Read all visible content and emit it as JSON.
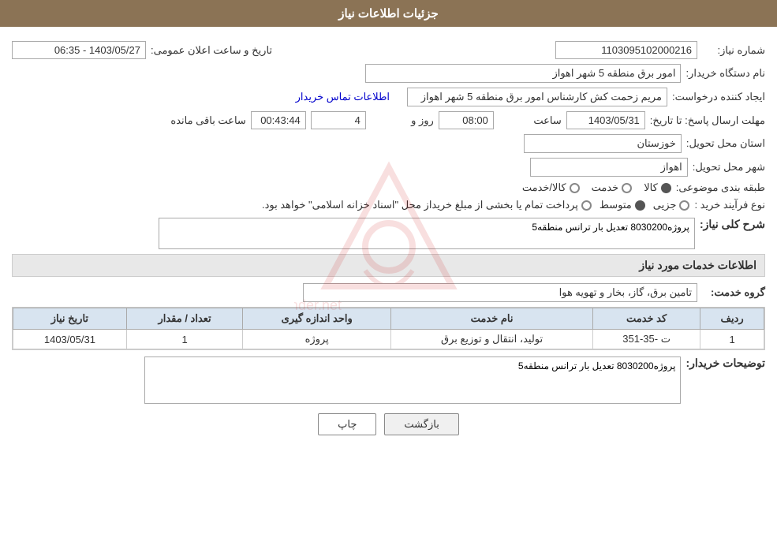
{
  "header": {
    "title": "جزئیات اطلاعات نیاز"
  },
  "fields": {
    "shomareNiaz_label": "شماره نیاز:",
    "shomareNiaz_value": "1103095102000216",
    "namDastgah_label": "نام دستگاه خریدار:",
    "namDastgah_value": "امور برق منطقه 5 شهر اهواز",
    "tarikhAlan_label": "تاریخ و ساعت اعلان عمومی:",
    "tarikhAlan_value": "1403/05/27 - 06:35",
    "ijadKonande_label": "ایجاد کننده درخواست:",
    "ijadKonande_value": "مریم زحمت کش کارشناس امور برق منطقه 5 شهر اهواز",
    "etelaat_link": "اطلاعات تماس خریدار",
    "mohlat_label": "مهلت ارسال پاسخ: تا تاریخ:",
    "mohlat_date": "1403/05/31",
    "mohlat_saat_label": "ساعت",
    "mohlat_saat": "08:00",
    "mohlat_roz_label": "روز و",
    "mohlat_roz": "4",
    "mohlat_mande_label": "ساعت باقی مانده",
    "mohlat_mande": "00:43:44",
    "ostan_label": "استان محل تحویل:",
    "ostan_value": "خوزستان",
    "shahr_label": "شهر محل تحویل:",
    "shahr_value": "اهواز",
    "tabaqe_label": "طبقه بندی موضوعی:",
    "tabaqe_options": [
      {
        "label": "کالا",
        "selected": true
      },
      {
        "label": "خدمت",
        "selected": false
      },
      {
        "label": "کالا/خدمت",
        "selected": false
      }
    ],
    "noeFarayand_label": "نوع فرآیند خرید :",
    "noeFarayand_options": [
      {
        "label": "جزیی",
        "selected": false
      },
      {
        "label": "متوسط",
        "selected": true
      },
      {
        "label": "پرداخت تمام یا بخشی از مبلغ خریداز محل \"اسناد خزانه اسلامی\" خواهد بود.",
        "selected": false
      }
    ],
    "sharhKolliNiaz_label": "شرح کلی نیاز:",
    "sharhKolliNiaz_value": "پروژه8030200 تعدیل بار ترانس منطقه5",
    "services_section_title": "اطلاعات خدمات مورد نیاز",
    "groheKhedmat_label": "گروه خدمت:",
    "groheKhedmat_value": "تامین برق، گاز، بخار و تهویه هوا",
    "table": {
      "headers": [
        "ردیف",
        "کد خدمت",
        "نام خدمت",
        "واحد اندازه گیری",
        "تعداد / مقدار",
        "تاریخ نیاز"
      ],
      "rows": [
        {
          "radif": "1",
          "kodKhedmat": "ت -35-351",
          "namKhedmat": "تولید، انتقال و توزیع برق",
          "vahed": "پروژه",
          "tedad": "1",
          "tarikh": "1403/05/31"
        }
      ]
    },
    "toseef_label": "توضیحات خریدار:",
    "toseef_value": "پروژه8030200 تعدیل بار ترانس منطقه5"
  },
  "buttons": {
    "print": "چاپ",
    "back": "بازگشت"
  }
}
